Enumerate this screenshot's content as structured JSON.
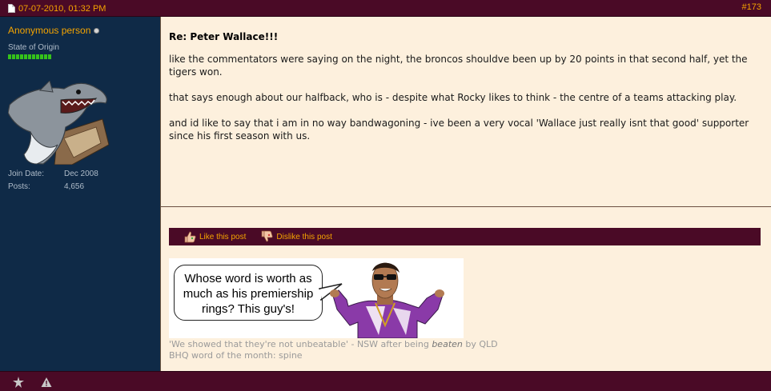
{
  "header": {
    "date": "07-07-2010, 01:32 PM",
    "post_number": "#173"
  },
  "user": {
    "name": "Anonymous person",
    "title": "State of Origin",
    "reputation_pips": 11,
    "join_label": "Join Date:",
    "join_value": "Dec 2008",
    "posts_label": "Posts:",
    "posts_value": "4,656"
  },
  "post": {
    "title": "Re: Peter Wallace!!!",
    "paragraphs": [
      "like the commentators were saying on the night, the broncos shouldve been up by 20 points in that second half, yet the tigers won.",
      "that says enough about our halfback, who is - despite what Rocky likes to think - the centre of a teams attacking play.",
      "and id like to say that i am in no way bandwagoning - ive been a very vocal 'Wallace just really isnt that good' supporter since his first season with us."
    ]
  },
  "actions": {
    "like_label": "Like this post",
    "dislike_label": "Dislike this post"
  },
  "signature": {
    "bubble_text": "Whose word is worth as much as his premiership rings? This guy's!",
    "quote_before": "'We showed that they're not unbeatable' - NSW after being ",
    "quote_emphasis": "beaten",
    "quote_after": " by QLD",
    "word_of_month": "BHQ word of the month: spine"
  },
  "footer": {
    "icons": [
      "star-burst-icon",
      "warning-icon"
    ]
  },
  "colors": {
    "bar": "#4a0a26",
    "accent": "#f5a400",
    "sidebar": "#0f2a47",
    "content": "#fdf0dd"
  }
}
